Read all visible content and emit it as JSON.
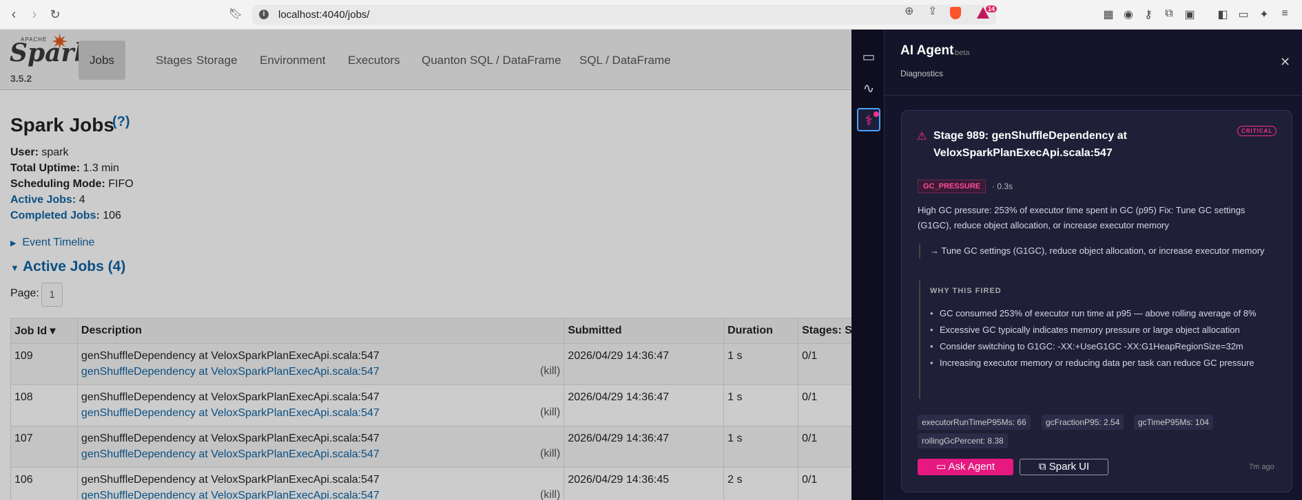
{
  "browser": {
    "url": "localhost:4040/jobs/",
    "badge_count": "14"
  },
  "spark": {
    "logo_apache": "APACHE",
    "logo_text": "Spark",
    "version": "3.5.2",
    "tabs": [
      {
        "label": "Jobs"
      },
      {
        "label": "Stages"
      },
      {
        "label": "Storage"
      },
      {
        "label": "Environment"
      },
      {
        "label": "Executors"
      },
      {
        "label": "Quanton SQL / DataFrame"
      },
      {
        "label": "SQL / DataFrame"
      }
    ],
    "title": "Spark Jobs",
    "help": "(?)",
    "info": {
      "user_label": "User:",
      "user": "spark",
      "uptime_label": "Total Uptime:",
      "uptime": "1.3 min",
      "sched_label": "Scheduling Mode:",
      "sched": "FIFO",
      "active_label": "Active Jobs:",
      "active": "4",
      "completed_label": "Completed Jobs:",
      "completed": "106"
    },
    "timeline": "Event Timeline",
    "active_jobs_heading": "Active Jobs (4)",
    "page_label": "Page:",
    "page_value": "1",
    "table": {
      "headers": [
        "Job Id ▾",
        "Description",
        "Submitted",
        "Duration",
        "Stages: S"
      ],
      "rows": [
        {
          "id": "109",
          "desc": "genShuffleDependency at VeloxSparkPlanExecApi.scala:547",
          "link": "genShuffleDependency at VeloxSparkPlanExecApi.scala:547",
          "kill": "(kill)",
          "submitted": "2026/04/29 14:36:47",
          "duration": "1 s",
          "stages": "0/1"
        },
        {
          "id": "108",
          "desc": "genShuffleDependency at VeloxSparkPlanExecApi.scala:547",
          "link": "genShuffleDependency at VeloxSparkPlanExecApi.scala:547",
          "kill": "(kill)",
          "submitted": "2026/04/29 14:36:47",
          "duration": "1 s",
          "stages": "0/1"
        },
        {
          "id": "107",
          "desc": "genShuffleDependency at VeloxSparkPlanExecApi.scala:547",
          "link": "genShuffleDependency at VeloxSparkPlanExecApi.scala:547",
          "kill": "(kill)",
          "submitted": "2026/04/29 14:36:47",
          "duration": "1 s",
          "stages": "0/1"
        },
        {
          "id": "106",
          "desc": "genShuffleDependency at VeloxSparkPlanExecApi.scala:547",
          "link": "genShuffleDependency at VeloxSparkPlanExecApi.scala:547",
          "kill": "(kill)",
          "submitted": "2026/04/29 14:36:45",
          "duration": "2 s",
          "stages": "0/1"
        }
      ]
    }
  },
  "agent": {
    "title": "AI Agent",
    "beta": "beta",
    "subtitle": "Diagnostics",
    "card": {
      "title": "Stage 989: genShuffleDependency at VeloxSparkPlanExecApi.scala:547",
      "severity": "CRITICAL",
      "tag": "GC_PRESSURE",
      "time": "· 0.3s",
      "description": "High GC pressure: 253% of executor time spent in GC (p95) Fix: Tune GC settings (G1GC), reduce object allocation, or increase executor memory",
      "fix": "→ Tune GC settings (G1GC), reduce object allocation, or increase executor memory",
      "why_title": "WHY THIS FIRED",
      "why": [
        "GC consumed 253% of executor run time at p95 — above rolling average of 8%",
        "Excessive GC typically indicates memory pressure or large object allocation",
        "Consider switching to G1GC: -XX:+UseG1GC -XX:G1HeapRegionSize=32m",
        "Increasing executor memory or reducing data per task can reduce GC pressure"
      ],
      "metrics": [
        "executorRunTimeP95Ms: 66",
        "gcFractionP95: 2.54",
        "gcTimeP95Ms: 104",
        "rollingGcPercent: 8.38"
      ],
      "ask_label": "Ask Agent",
      "ui_label": "Spark UI",
      "ago": "7m ago"
    }
  }
}
